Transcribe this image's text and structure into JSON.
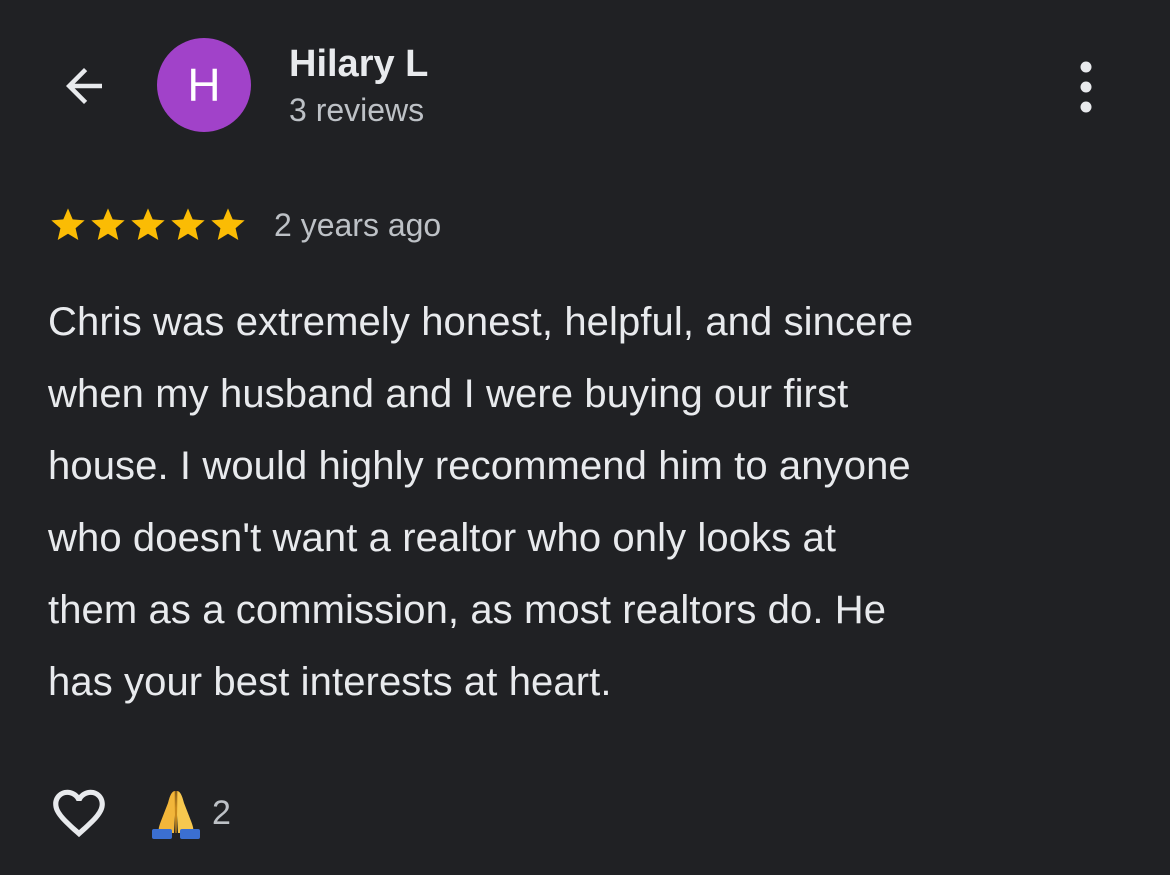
{
  "header": {
    "avatar_letter": "H",
    "avatar_color": "#a142c9",
    "user_name": "Hilary L",
    "review_count": "3 reviews",
    "back_icon": "arrow-left-icon",
    "more_icon": "more-vertical-icon"
  },
  "review": {
    "rating": 5,
    "rating_max": 5,
    "star_color": "#fbbc04",
    "time_ago": "2 years ago",
    "text": "Chris was extremely honest, helpful, and sincere\nwhen my husband and I were buying our first\nhouse. I would highly recommend him to anyone\nwho doesn't want a realtor who only looks at\nthem as a commission, as most realtors do. He\nhas your best interests at heart."
  },
  "actions": {
    "like_icon": "heart-outline-icon",
    "reaction_icon": "folded-hands-emoji",
    "reaction_count": "2"
  }
}
